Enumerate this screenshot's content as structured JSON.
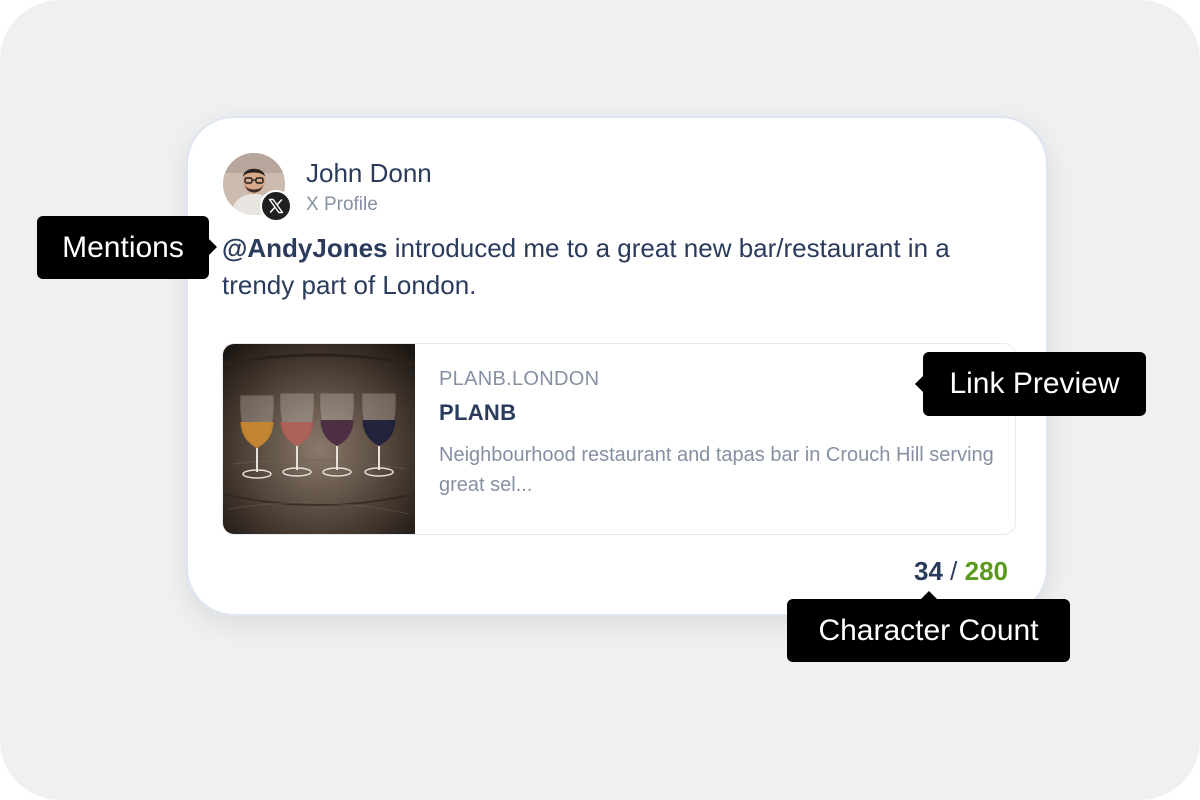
{
  "author": {
    "name": "John Donn",
    "profile_type": "X Profile",
    "avatar_icon": "person-avatar",
    "platform_icon": "x-logo-icon"
  },
  "post": {
    "mention": "@AndyJones",
    "text": " introduced me to a great new bar/restaurant in a trendy part of London."
  },
  "link_preview": {
    "domain": "PLANB.LONDON",
    "title": "PLANB",
    "description": "Neighbourhood restaurant and tapas bar in Crouch Hill serving great sel...",
    "image_icon": "wine-glasses-image"
  },
  "character_count": {
    "used": "34",
    "separator": " / ",
    "limit": "280",
    "used_color": "#2a3b5c",
    "limit_color": "#5a9a1d"
  },
  "tooltips": {
    "mentions": "Mentions",
    "link_preview": "Link Preview",
    "character_count": "Character Count"
  },
  "colors": {
    "background": "#f0f0f0",
    "card": "#ffffff",
    "text_primary": "#2a3b5c",
    "text_secondary": "#8590a3",
    "tooltip": "#000000"
  }
}
